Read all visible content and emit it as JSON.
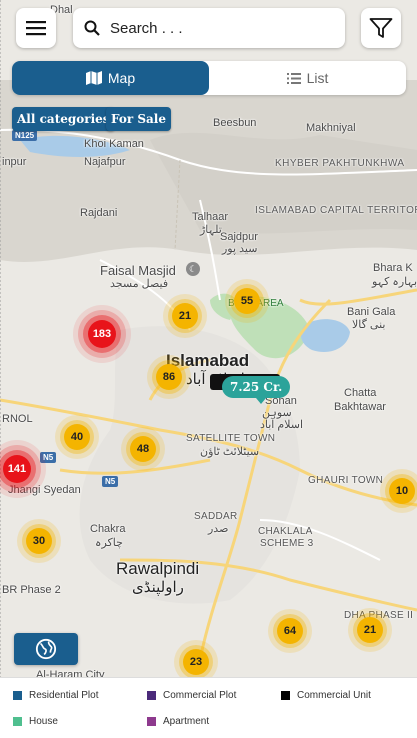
{
  "search": {
    "placeholder": "Search . . ."
  },
  "view_toggle": {
    "map_label": "Map",
    "list_label": "List",
    "active": "map"
  },
  "filters": {
    "category_chip": "All categories",
    "purpose_chip": "For Sale"
  },
  "map_labels": {
    "dhal": "Dhal",
    "beesbun": "Beesbun",
    "makhniyal": "Makhniyal",
    "khoi_kaman": "Khoi Kaman",
    "najafpur": "Najafpur",
    "inpur": "inpur",
    "khyber": "KHYBER PAKHTUNKHWA",
    "rajdani": "Rajdani",
    "talhaar": "Talhaar",
    "talhaar_ur": "تلہاڑ",
    "ict": "ISLAMABAD CAPITAL TERRITORY",
    "sajdpur": "Sajdpur",
    "sajdpur_ur": "سید پور",
    "bhara_k": "Bhara K",
    "bhara_k_ur": "بہارہ کہو",
    "faisal_masjid": "Faisal Masjid",
    "faisal_masjid_ur": "فیصل مسجد",
    "blue_area": "BLUE AREA",
    "bani_gala": "Bani Gala",
    "bani_gala_ur": "بنی گالا",
    "islamabad": "Islamabad",
    "islamabad_ur": "اسلام آباد",
    "sohan": "Sohan",
    "sohan_ur": "سوہن",
    "islamabad_small_ur": "اسلام آباد",
    "chatta": "Chatta",
    "bakhtawar": "Bakhtawar",
    "rnol": "RNOL",
    "satellite_town": "SATELLITE TOWN",
    "satellite_town_ur": "سیٹلائٹ ٹاؤن",
    "jhangi_syedan": "Jhangi Syedan",
    "ghauri_town": "GHAURI TOWN",
    "saddar": "SADDAR",
    "saddar_ur": "صدر",
    "chaklala": "CHAKLALA",
    "scheme3": "SCHEME 3",
    "chakra": "Chakra",
    "chakra_ur": "چاکرہ",
    "rawalpindi": "Rawalpindi",
    "rawalpindi_ur": "راولپنڈی",
    "br_phase2": "BR Phase 2",
    "dha_phase2": "DHA PHASE II",
    "al_haram": "Al-Haram City",
    "n125": "N125",
    "n5a": "N5",
    "n5b": "N5"
  },
  "clusters": [
    {
      "count": "183",
      "level": "red"
    },
    {
      "count": "141",
      "level": "red"
    },
    {
      "count": "55",
      "level": "yellow"
    },
    {
      "count": "21",
      "level": "yellow"
    },
    {
      "count": "86",
      "level": "yellow"
    },
    {
      "count": "40",
      "level": "yellow"
    },
    {
      "count": "48",
      "level": "yellow"
    },
    {
      "count": "10",
      "level": "yellow"
    },
    {
      "count": "30",
      "level": "yellow"
    },
    {
      "count": "64",
      "level": "yellow"
    },
    {
      "count": "21",
      "level": "yellow"
    },
    {
      "count": "23",
      "level": "yellow"
    }
  ],
  "price_marker": "7.25 Cr.",
  "legend": [
    {
      "label": "Residential Plot",
      "color": "#1a5e8e"
    },
    {
      "label": "Commercial Plot",
      "color": "#4b2a7a"
    },
    {
      "label": "Commercial Unit",
      "color": "#000000"
    },
    {
      "label": "House",
      "color": "#4fbf8f"
    },
    {
      "label": "Apartment",
      "color": "#8e3a8e"
    }
  ],
  "icons": {
    "menu": "hamburger-menu-icon",
    "search": "search-icon",
    "filter": "filter-funnel-icon",
    "map_tab": "map-icon",
    "list_tab": "list-icon",
    "globe": "globe-icon"
  }
}
